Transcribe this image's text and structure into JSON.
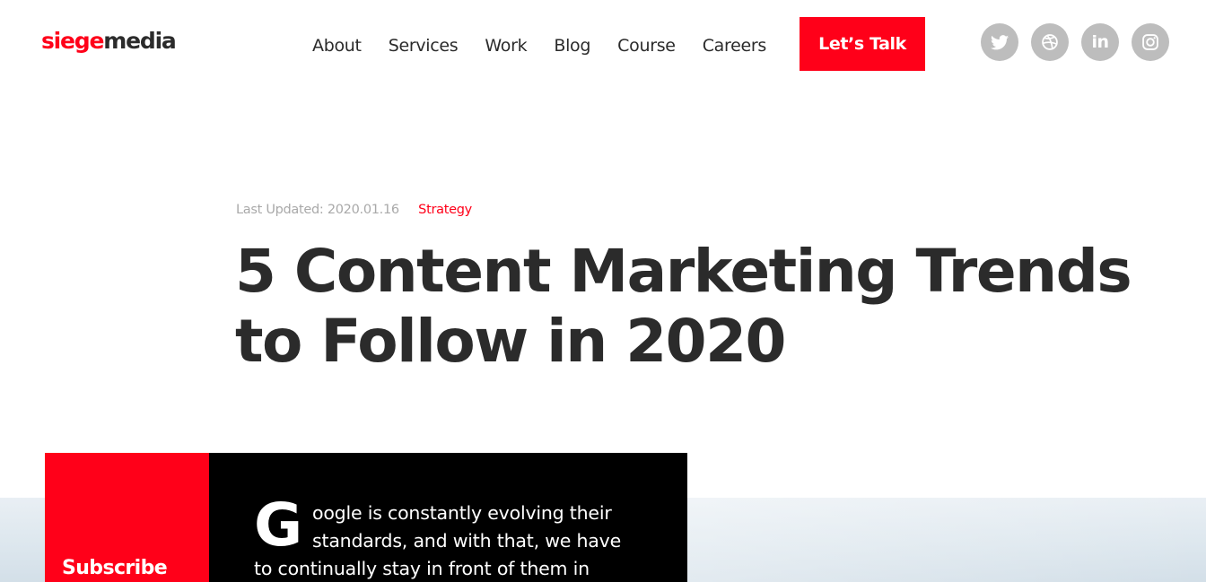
{
  "header": {
    "logo": {
      "part1": "siege",
      "part2": "media"
    },
    "nav": {
      "items": [
        {
          "label": "About"
        },
        {
          "label": "Services"
        },
        {
          "label": "Work"
        },
        {
          "label": "Blog"
        },
        {
          "label": "Course"
        },
        {
          "label": "Careers"
        }
      ]
    },
    "cta_label": "Let’s Talk",
    "social": {
      "icons": [
        "twitter-icon",
        "dribbble-icon",
        "linkedin-icon",
        "instagram-icon"
      ],
      "linkedin_text": "in"
    }
  },
  "article": {
    "last_updated": "Last Updated: 2020.01.16",
    "category": "Strategy",
    "title": "5 Content Marketing Trends to Follow in 2020"
  },
  "sidebar": {
    "subscribe_label": "Subscribe"
  },
  "intro": {
    "drop_cap": "G",
    "lines": [
      "oogle is constantly evolving their",
      "standards, and with that, we have",
      "to continually stay in front of them in"
    ]
  },
  "colors": {
    "brand_red": "#ff0019",
    "text_dark": "#2b2b2b",
    "meta_gray": "#a9a9a9",
    "social_gray": "#bdbdbd",
    "intro_bg": "#000000"
  }
}
